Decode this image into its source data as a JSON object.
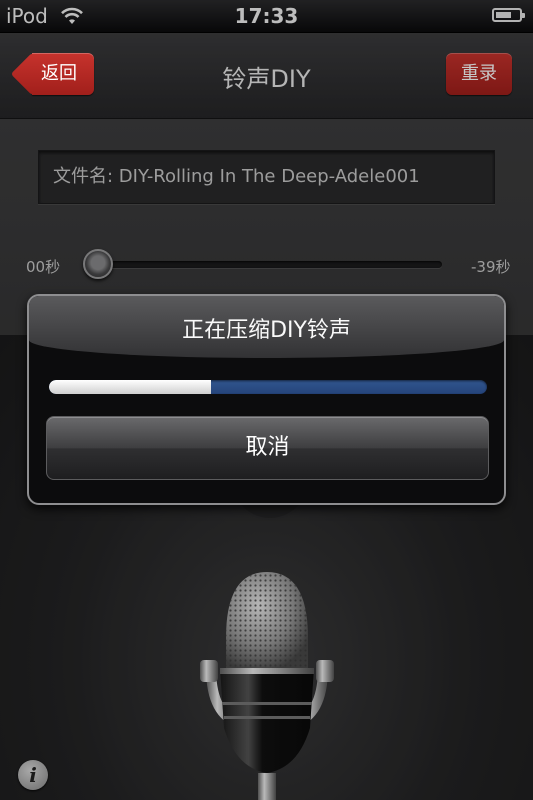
{
  "status_bar": {
    "carrier": "iPod",
    "time": "17:33",
    "battery_level": 0.7
  },
  "nav": {
    "back_label": "返回",
    "title": "铃声DIY",
    "rerecord_label": "重录"
  },
  "editor": {
    "filename": "文件名: DIY-Rolling In The Deep-Adele001",
    "time_elapsed": "00秒",
    "time_remaining": "-39秒",
    "playback_position": 0.0
  },
  "dialog": {
    "title": "正在压缩DIY铃声",
    "progress": 0.37,
    "cancel_label": "取消"
  },
  "icons": {
    "wifi": "wifi-icon",
    "battery": "battery-icon",
    "microphone": "microphone-icon",
    "info": "info-icon"
  },
  "colors": {
    "accent_red": "#b42824",
    "progress_blue": "#2c4f88"
  },
  "info_glyph": "i"
}
